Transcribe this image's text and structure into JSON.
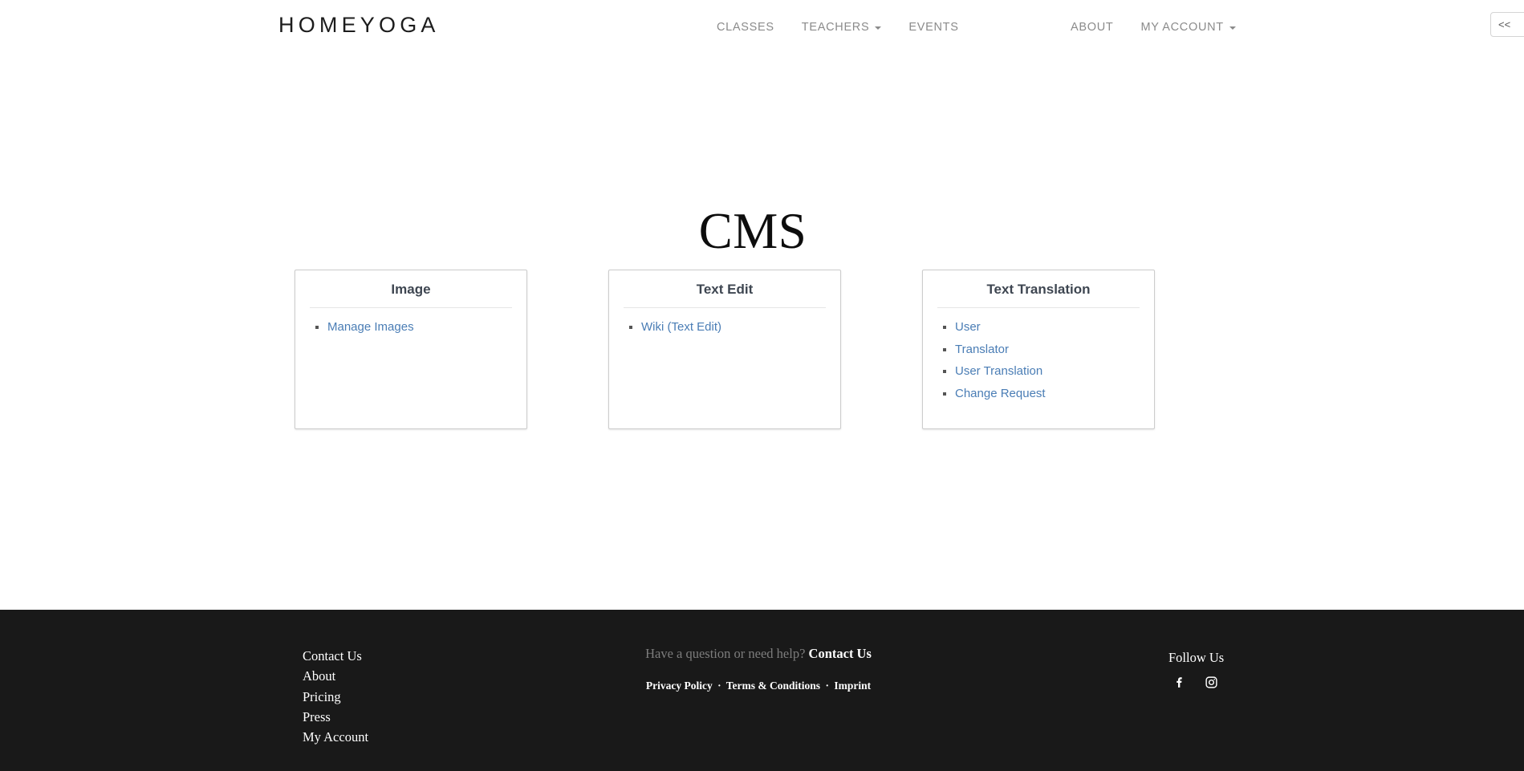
{
  "header": {
    "brand": "HOMEYOGA",
    "nav_center": [
      {
        "label": "CLASSES",
        "has_caret": false
      },
      {
        "label": "TEACHERS",
        "has_caret": true
      },
      {
        "label": "EVENTS",
        "has_caret": false
      }
    ],
    "nav_right": [
      {
        "label": "ABOUT",
        "has_caret": false
      },
      {
        "label": "MY ACCOUNT",
        "has_caret": true
      }
    ],
    "edge_toggle_label": "<<"
  },
  "main": {
    "page_title": "CMS",
    "cards": [
      {
        "title": "Image",
        "links": [
          {
            "label": "Manage Images"
          }
        ]
      },
      {
        "title": "Text Edit",
        "links": [
          {
            "label": "Wiki (Text Edit)"
          }
        ]
      },
      {
        "title": "Text Translation",
        "links": [
          {
            "label": "User"
          },
          {
            "label": "Translator"
          },
          {
            "label": "User Translation"
          },
          {
            "label": "Change Request"
          }
        ]
      }
    ]
  },
  "footer": {
    "links": [
      {
        "label": "Contact Us"
      },
      {
        "label": "About"
      },
      {
        "label": "Pricing"
      },
      {
        "label": "Press"
      },
      {
        "label": "My Account"
      }
    ],
    "help_text": "Have a question or need help?",
    "help_link": "Contact Us",
    "legal": [
      {
        "label": "Privacy Policy"
      },
      {
        "label": "Terms & Conditions"
      },
      {
        "label": "Imprint"
      }
    ],
    "legal_separator": "·",
    "follow_label": "Follow Us",
    "social": [
      {
        "name": "facebook"
      },
      {
        "name": "instagram"
      }
    ]
  },
  "colors": {
    "link_blue": "#4a7db5",
    "nav_gray": "#8b8b8b",
    "footer_bg": "#191919",
    "card_border": "#cccccc"
  }
}
